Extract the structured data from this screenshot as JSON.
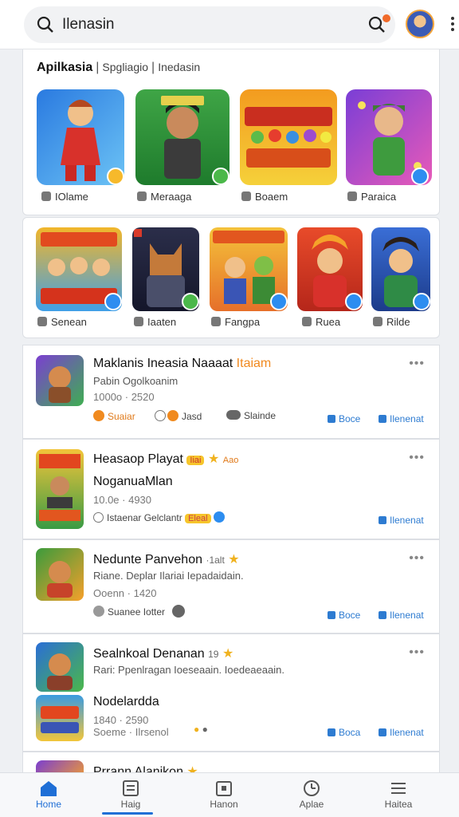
{
  "search": {
    "value": "Ilenasin"
  },
  "section1": {
    "title": "Apilkasia",
    "sub1": "Spgliagio",
    "sub2": "Inedasin",
    "apps": [
      {
        "label": "IOlame",
        "icon": "home-icon"
      },
      {
        "label": "Meraaga",
        "icon": "group-icon"
      },
      {
        "label": "Boaem",
        "icon": "chat-icon"
      },
      {
        "label": "Paraica",
        "icon": "pin-icon"
      }
    ]
  },
  "section2": {
    "apps": [
      {
        "label": "Senean"
      },
      {
        "label": "Iaaten"
      },
      {
        "label": "Fangpa"
      },
      {
        "label": "Ruea"
      },
      {
        "label": "Rilde"
      }
    ]
  },
  "feed": [
    {
      "title": "Maklanis Ineasia Naaaat",
      "title_hl": "Itaiam",
      "sub": "Pabin Ogolkoanim",
      "meta": "1000o · 2520",
      "tag1": "Suaiar",
      "tag2": "Jasd",
      "tag3": "Slainde",
      "act1": "Boce",
      "act2": "Ilenenat"
    },
    {
      "title": "Heasaop Playat",
      "title_tag": "Aao",
      "title2": "NoganuaMlan",
      "meta": "10.0e · 4930",
      "tag1": "Istaenar Gelclantr",
      "pill": "Eleal",
      "act2": "Ilenenat"
    },
    {
      "title": "Nedunte Panvehon",
      "title_small": "·1alt",
      "sub": "Riane. Deplar Ilariai Iepadaidain.",
      "meta": "Ooenn · 1420",
      "tag1": "Suanee Iotter",
      "act1": "Boce",
      "act2": "Ilenenat"
    },
    {
      "title": "Sealnkoal Denanan",
      "title_small": "19",
      "sub": "Rari: Ppenlragan Ioeseaain. Ioedeaeaain.",
      "title2": "Nodelardda",
      "meta": "1840 · 2590",
      "meta2": "Soeme · Ilrsenol",
      "act1": "Boca",
      "act2": "Ilenenat"
    },
    {
      "title": "Prrann Alanikon"
    }
  ],
  "nav": [
    {
      "label": "Home",
      "icon": "home-icon"
    },
    {
      "label": "Haig",
      "icon": "grid-icon"
    },
    {
      "label": "Hanon",
      "icon": "calendar-icon"
    },
    {
      "label": "Aplae",
      "icon": "clock-icon"
    },
    {
      "label": "Haitea",
      "icon": "menu-icon"
    }
  ]
}
